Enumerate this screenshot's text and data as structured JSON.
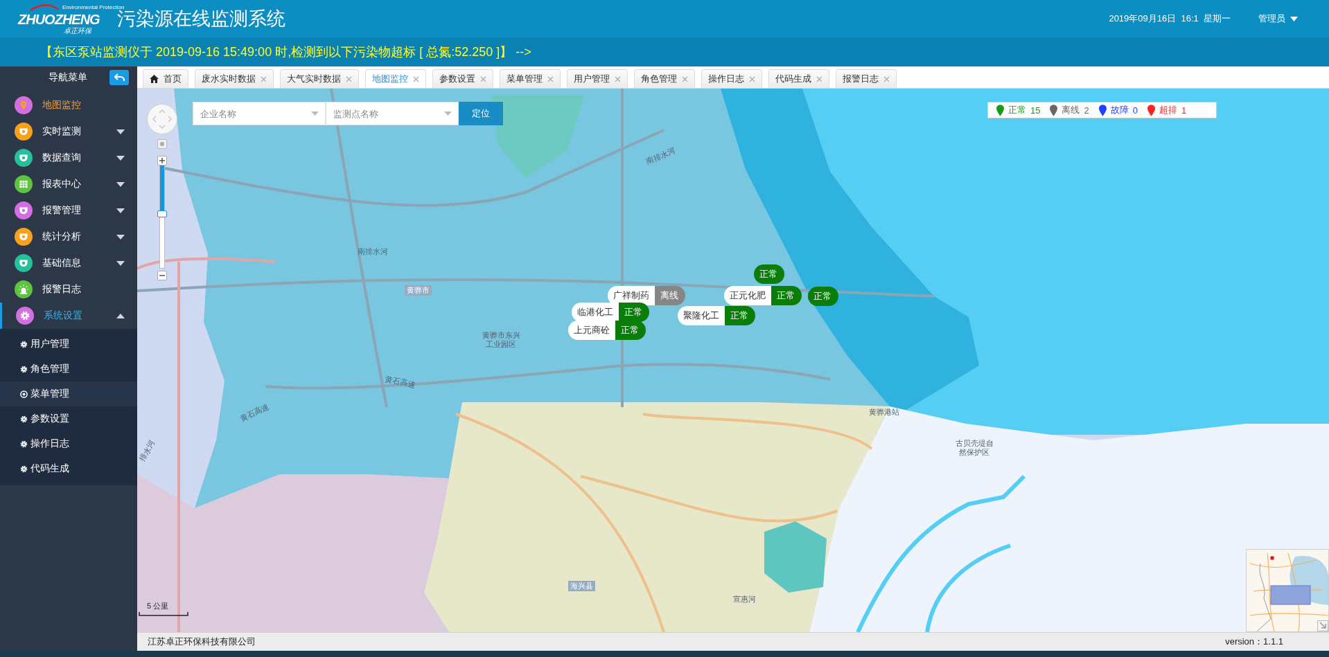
{
  "header": {
    "logo_text": "ZHUOZHENG",
    "logo_tagline": "Environmental Protection",
    "logo_subtitle": "卓正环保",
    "title": "污染源在线监测系统",
    "datetime": "2019年09月16日  16:1  星期一",
    "user": "管理员"
  },
  "alert": {
    "text": "【东区泵站监测仪于 2019-09-16 15:49:00 时,检测到以下污染物超标 [ 总氮:52.250 ]】 -->"
  },
  "sidebar": {
    "title": "导航菜单",
    "items": [
      {
        "label": "地图监控",
        "color": "#d36fe0",
        "selected": true
      },
      {
        "label": "实时监测",
        "color": "#f7a21c",
        "selected": false,
        "expanded": false
      },
      {
        "label": "数据查询",
        "color": "#27bf9c",
        "selected": false,
        "expanded": false
      },
      {
        "label": "报表中心",
        "color": "#5cc43e",
        "selected": false,
        "expanded": false
      },
      {
        "label": "报警管理",
        "color": "#d36fe0",
        "selected": false,
        "expanded": false
      },
      {
        "label": "统计分析",
        "color": "#f7a21c",
        "selected": false,
        "expanded": false
      },
      {
        "label": "基础信息",
        "color": "#27bf9c",
        "selected": false,
        "expanded": false
      },
      {
        "label": "报警日志",
        "color": "#5cc43e",
        "selected": false
      },
      {
        "label": "系统设置",
        "color": "#d36fe0",
        "selected": false,
        "expanded": true,
        "children": [
          {
            "label": "用户管理",
            "selected": false
          },
          {
            "label": "角色管理",
            "selected": false
          },
          {
            "label": "菜单管理",
            "selected": true
          },
          {
            "label": "参数设置",
            "selected": false
          },
          {
            "label": "操作日志",
            "selected": false
          },
          {
            "label": "代码生成",
            "selected": false
          }
        ]
      }
    ]
  },
  "tabs": [
    {
      "label": "首页",
      "kind": "home",
      "selected": false
    },
    {
      "label": "废水实时数据",
      "kind": "closable",
      "selected": false
    },
    {
      "label": "大气实时数据",
      "kind": "closable",
      "selected": false
    },
    {
      "label": "地图监控",
      "kind": "closable",
      "selected": true
    },
    {
      "label": "参数设置",
      "kind": "closable",
      "selected": false
    },
    {
      "label": "菜单管理",
      "kind": "closable",
      "selected": false
    },
    {
      "label": "用户管理",
      "kind": "closable",
      "selected": false
    },
    {
      "label": "角色管理",
      "kind": "closable",
      "selected": false
    },
    {
      "label": "操作日志",
      "kind": "closable",
      "selected": false
    },
    {
      "label": "代码生成",
      "kind": "closable",
      "selected": false
    },
    {
      "label": "报警日志",
      "kind": "closable",
      "selected": false
    }
  ],
  "map": {
    "company_select": {
      "placeholder": "企业名称"
    },
    "station_select": {
      "placeholder": "监测点名称"
    },
    "locate_button": "定位",
    "legend": [
      {
        "label": "正常",
        "count": "15",
        "color": "#1a9a1a"
      },
      {
        "label": "离线",
        "count": "2",
        "color": "#666666"
      },
      {
        "label": "故障",
        "count": "0",
        "color": "#2040ff"
      },
      {
        "label": "超排",
        "count": "1",
        "color": "#ff2020"
      }
    ],
    "zoom_slider": {
      "level": 0.47
    },
    "labels": [
      {
        "text": "南排水河",
        "kind": "place"
      },
      {
        "text": "南排水河",
        "kind": "place"
      },
      {
        "text": "黄骅市",
        "kind": "town"
      },
      {
        "text": "黄骅市东兴工业园区",
        "kind": "place"
      },
      {
        "text": "黄石高速",
        "kind": "place"
      },
      {
        "text": "黄石高速",
        "kind": "place"
      },
      {
        "text": "黄骅港站",
        "kind": "place"
      },
      {
        "text": "古贝壳堤自然保护区",
        "kind": "place"
      },
      {
        "text": "海兴县",
        "kind": "town"
      },
      {
        "text": "宣惠河",
        "kind": "place"
      },
      {
        "text": "排水河",
        "kind": "place"
      }
    ],
    "markers": [
      {
        "status": "正常",
        "kind": "normal"
      },
      {
        "name": "广祥制药",
        "status": "离线",
        "kind": "offline"
      },
      {
        "name": "正元化肥",
        "status": "正常",
        "kind": "normal"
      },
      {
        "status": "正常",
        "kind": "normal"
      },
      {
        "name": "临港化工",
        "status": "正常",
        "kind": "normal"
      },
      {
        "name": "上元商砼",
        "status": "正常",
        "kind": "normal"
      },
      {
        "name": "聚隆化工",
        "status": "正常",
        "kind": "normal"
      }
    ],
    "scale": "5 公里"
  },
  "footer": {
    "company": "江苏卓正环保科技有限公司",
    "version": "version：1.1.1"
  }
}
